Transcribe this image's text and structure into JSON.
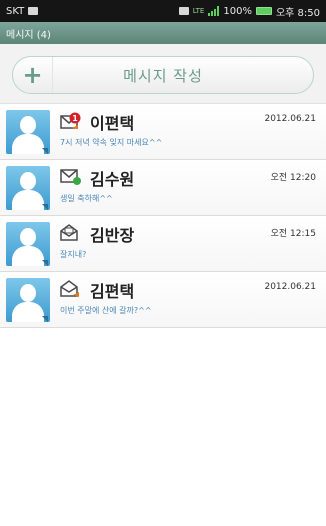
{
  "status_bar": {
    "carrier": "SKT",
    "network": "LTE",
    "battery": "100%",
    "time": "오후 8:50"
  },
  "title_bar": {
    "title": "메시지 (4)"
  },
  "compose": {
    "plus": "+",
    "label": "메시지 작성"
  },
  "messages": [
    {
      "name": "이편택",
      "preview": "7시 저녁 약속 잊지 마세요^^",
      "date": "2012.06.21",
      "status": "unread-badge",
      "badge": "1"
    },
    {
      "name": "김수원",
      "preview": "생일 축하해^^",
      "date": "오전 12:20",
      "status": "sent-check"
    },
    {
      "name": "김반장",
      "preview": "잘지내?",
      "date": "오전 12:15",
      "status": "read"
    },
    {
      "name": "김편택",
      "preview": "이번 주말에 산에 갈까?^^",
      "date": "2012.06.21",
      "status": "reply"
    }
  ],
  "colors": {
    "accent": "#6a9c8c",
    "title_bar": "#5b8577",
    "badge": "#d4202a",
    "preview": "#4a86b8"
  }
}
